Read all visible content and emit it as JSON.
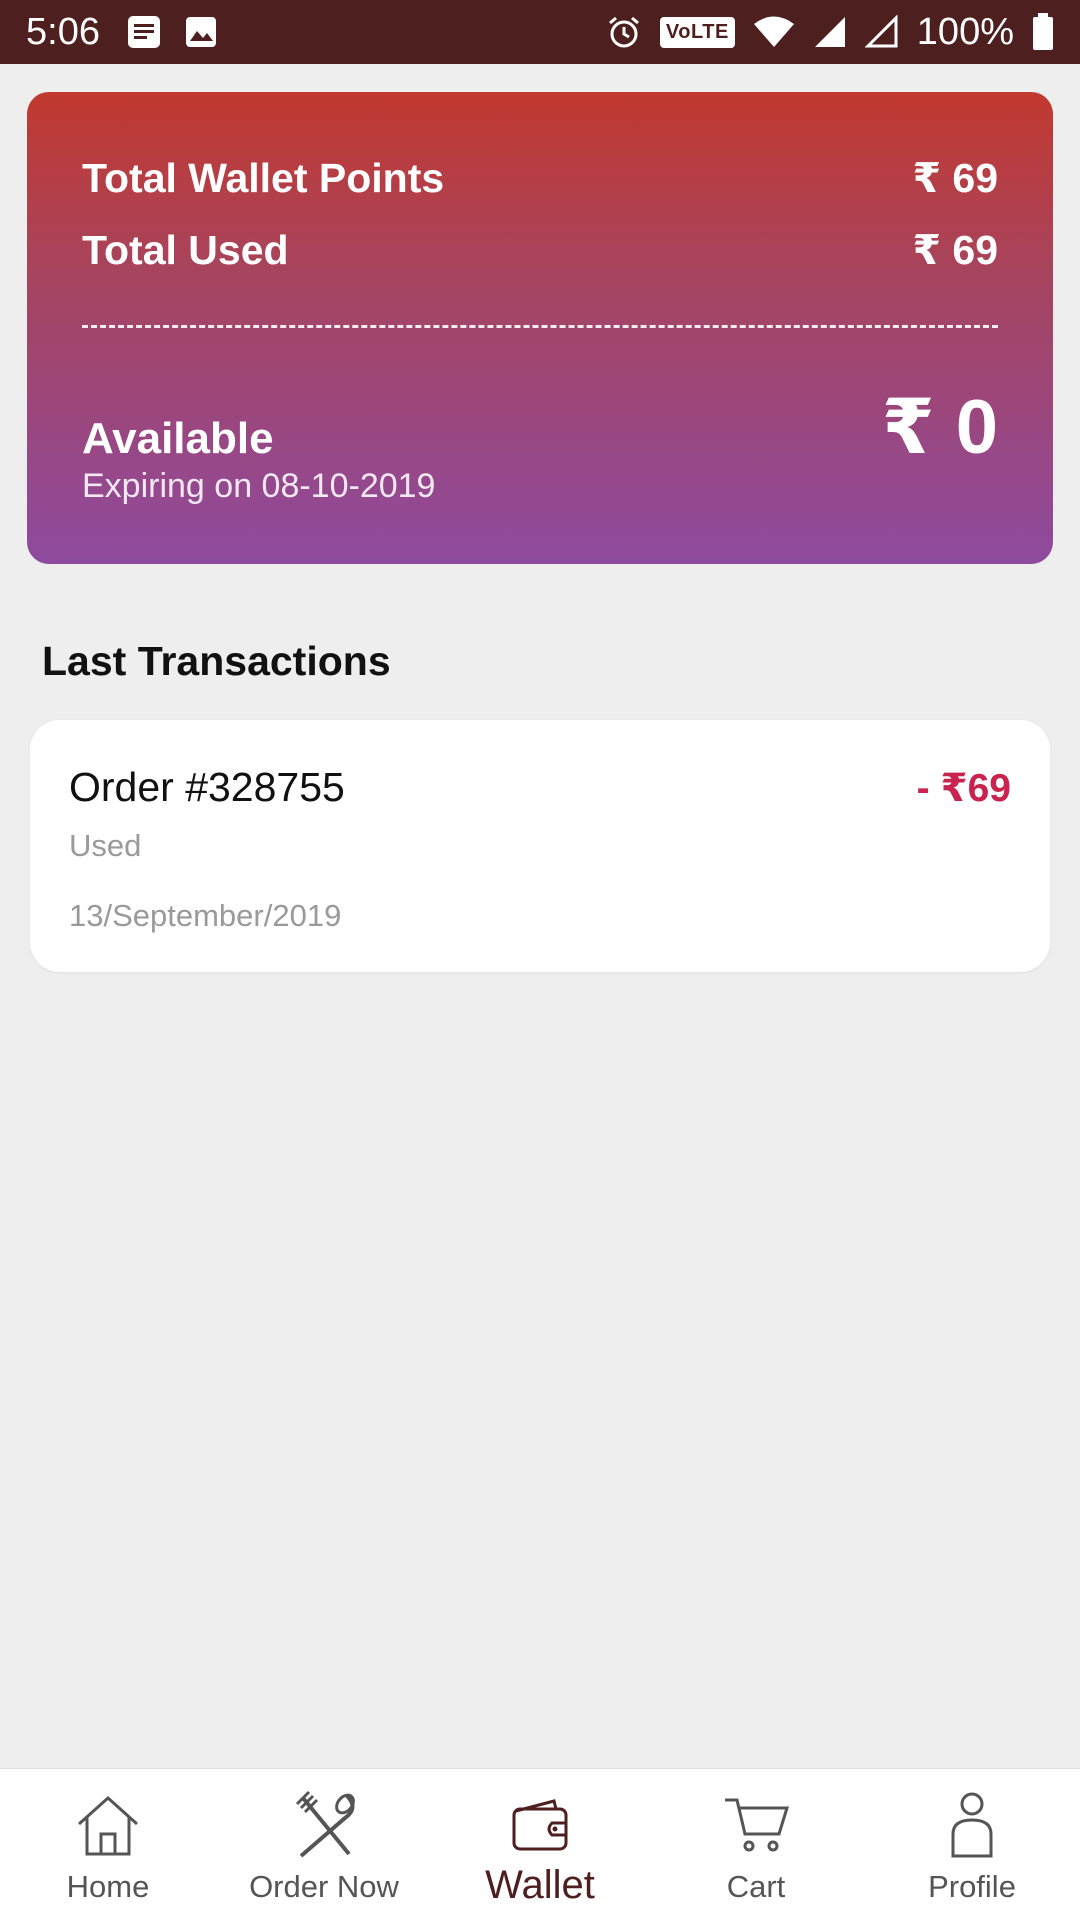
{
  "status_bar": {
    "time": "5:06",
    "volte": "VoLTE",
    "battery": "100%",
    "icons": [
      "document-icon",
      "image-icon",
      "alarm-icon",
      "volte-icon",
      "wifi-icon",
      "signal-icon",
      "signal-empty-icon",
      "battery-icon"
    ]
  },
  "wallet": {
    "total_points_label": "Total Wallet Points",
    "total_points_value": "₹ 69",
    "total_used_label": "Total Used",
    "total_used_value": "₹ 69",
    "available_label": "Available",
    "available_value": "₹ 0",
    "expiry": "Expiring on 08-10-2019",
    "gradient": [
      "#c2392f",
      "#8e4a9e"
    ]
  },
  "transactions": {
    "title": "Last Transactions",
    "items": [
      {
        "order": "Order #328755",
        "amount": "- ₹69",
        "type": "Used",
        "date": "13/September/2019"
      }
    ]
  },
  "bottom_nav": {
    "items": [
      {
        "label": "Home",
        "icon": "home-icon"
      },
      {
        "label": "Order Now",
        "icon": "fork-spoon-icon"
      },
      {
        "label": "Wallet",
        "icon": "wallet-icon",
        "active": true
      },
      {
        "label": "Cart",
        "icon": "cart-icon"
      },
      {
        "label": "Profile",
        "icon": "profile-icon"
      }
    ],
    "active_color": "#4e1f1f"
  },
  "colors": {
    "status_bar": "#4e1f1f",
    "amount_negative": "#c8244f"
  }
}
